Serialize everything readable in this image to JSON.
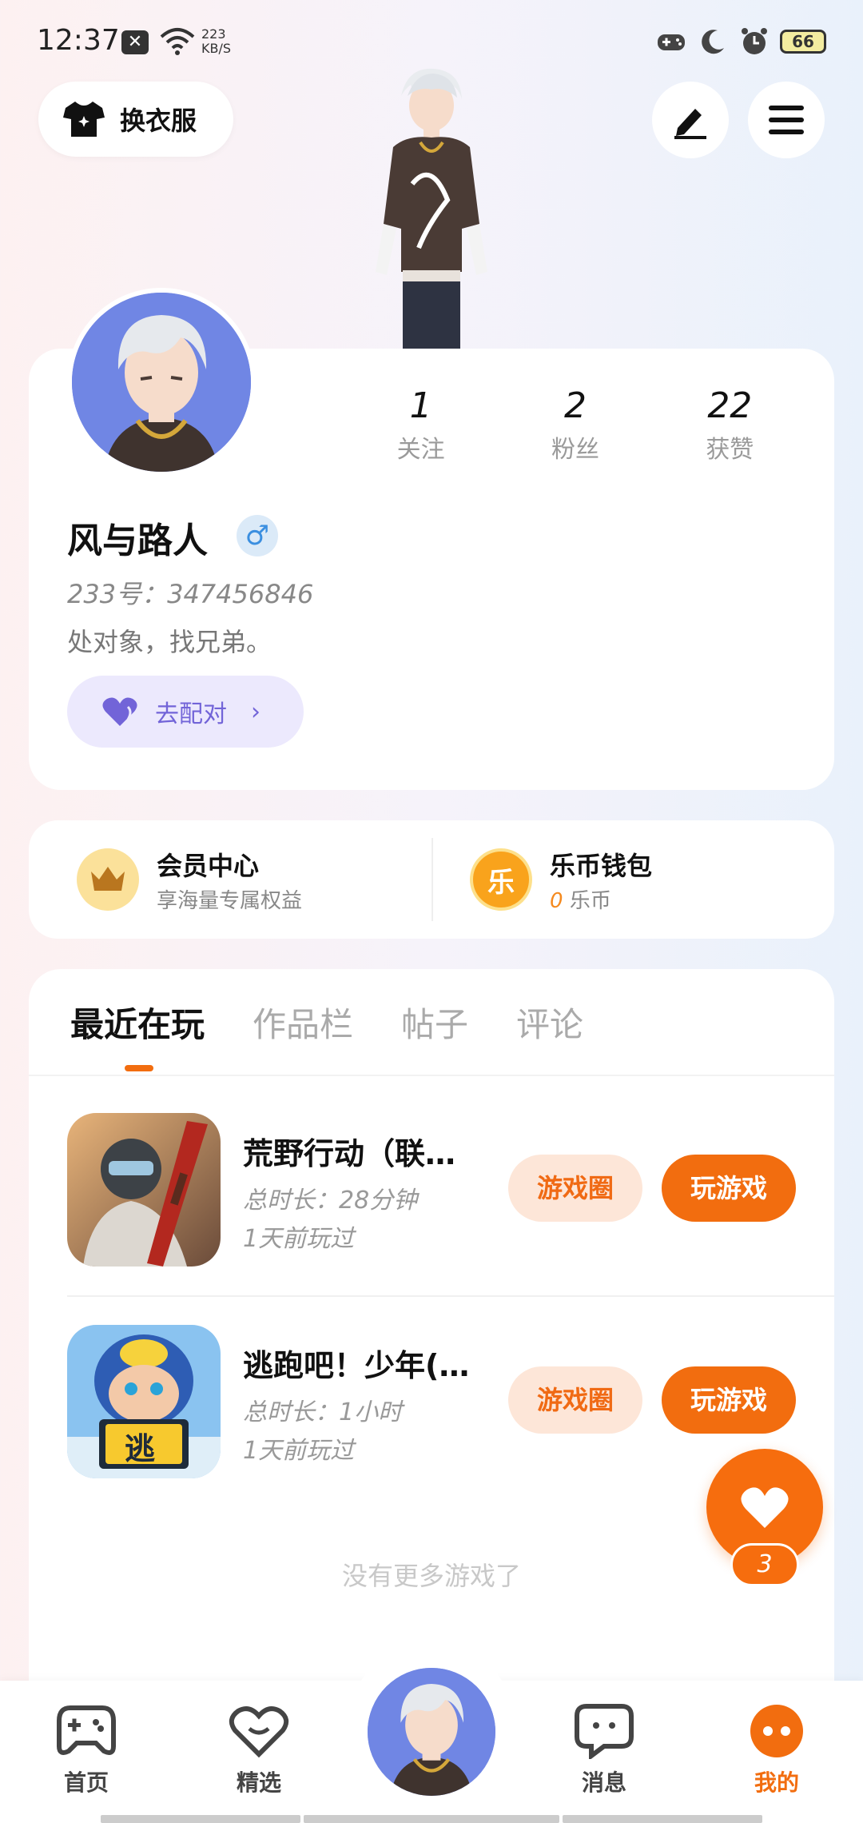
{
  "status_bar": {
    "time": "12:37",
    "notification_icon": "x-box-icon",
    "net_speed_value": "223",
    "net_speed_unit": "KB/S",
    "battery": "66"
  },
  "top": {
    "outfit_label": "换衣服"
  },
  "profile": {
    "stats": [
      {
        "num": "1",
        "label": "关注"
      },
      {
        "num": "2",
        "label": "粉丝"
      },
      {
        "num": "22",
        "label": "获赞"
      }
    ],
    "username": "风与路人",
    "gender_symbol": "♂",
    "user_id": "233号：347456846",
    "bio": "处对象，找兄弟。",
    "match_label": "去配对",
    "match_chevron": "›"
  },
  "member": {
    "vip_title": "会员中心",
    "vip_sub": "享海量专属权益",
    "wallet_icon_char": "乐",
    "wallet_title": "乐币钱包",
    "wallet_amount": "0",
    "wallet_unit": "乐币"
  },
  "tabs": [
    "最近在玩",
    "作品栏",
    "帖子",
    "评论"
  ],
  "games": [
    {
      "name": "荒野行动（联…",
      "duration": "总时长：28分钟",
      "last_played": "1天前玩过",
      "circle_label": "游戏圈",
      "play_label": "玩游戏"
    },
    {
      "name": "逃跑吧！少年(…",
      "duration": "总时长：1小时",
      "last_played": "1天前玩过",
      "circle_label": "游戏圈",
      "play_label": "玩游戏",
      "icon_char": "逃"
    }
  ],
  "no_more": "没有更多游戏了",
  "fab": {
    "count": "3"
  },
  "nav": [
    {
      "label": "首页"
    },
    {
      "label": "精选"
    },
    {
      "label": "消息"
    },
    {
      "label": "我的"
    }
  ],
  "colors": {
    "accent": "#f26d0f",
    "match_purple": "#7264d8",
    "avatar_blue": "#6f86e6"
  }
}
